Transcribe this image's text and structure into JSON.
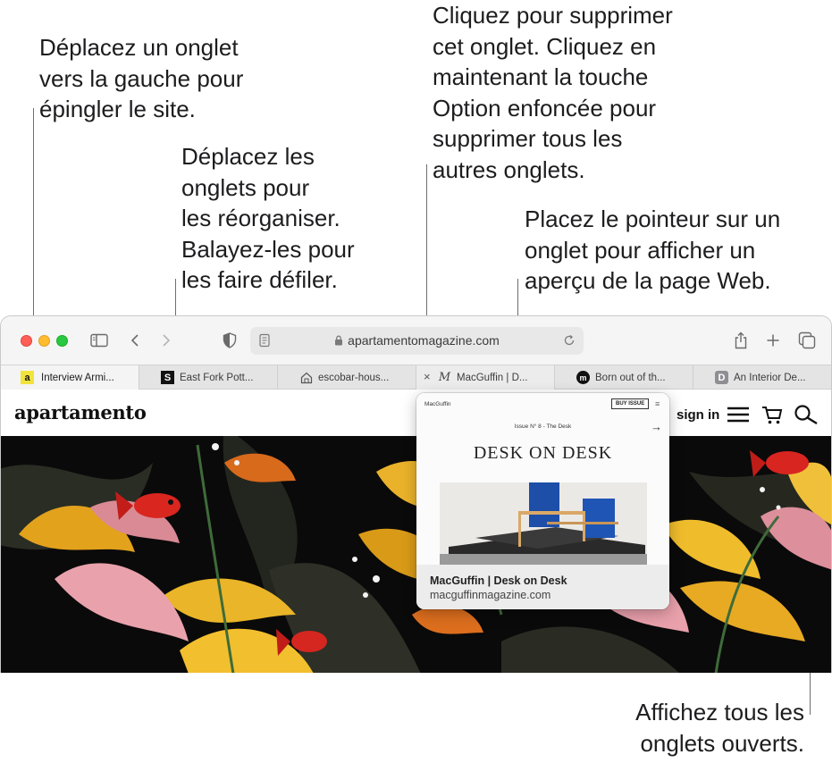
{
  "callouts": {
    "pin_tab": "Déplacez un onglet\nvers la gauche pour\népingler le site.",
    "reorder_tabs": "Déplacez les\nonglets pour\nles réorganiser.\nBalayez-les pour\nles faire défiler.",
    "close_tab": "Cliquez pour supprimer\ncet onglet. Cliquez en\nmaintenant la touche\nOption enfoncée pour\nsupprimer tous les\nautres onglets.",
    "hover_preview": "Placez le pointeur sur un\nonglet pour afficher un\naperçu de la page Web.",
    "show_all_tabs": "Affichez tous les\nonglets ouverts."
  },
  "toolbar": {
    "url": "apartamentomagazine.com",
    "icons": [
      "sidebar-icon",
      "back-icon",
      "forward-icon",
      "privacy-report-icon",
      "page-menu-icon",
      "lock-icon",
      "reload-icon",
      "share-icon",
      "new-tab-icon",
      "tab-overview-icon"
    ]
  },
  "tabs": [
    {
      "label": "Interview Armi...",
      "favicon": "a",
      "favicon_color": "#f2e33c",
      "favicon_text_color": "#111111"
    },
    {
      "label": "East Fork Pott...",
      "favicon": "S",
      "favicon_color": "#111111",
      "favicon_text_color": "#ffffff"
    },
    {
      "label": "escobar-hous...",
      "favicon": "",
      "favicon_color": "none",
      "favicon_text_color": "#555555"
    },
    {
      "label": "MacGuffin | D...",
      "favicon": "M",
      "favicon_color": "none",
      "favicon_text_color": "#444444"
    },
    {
      "label": "Born out of th...",
      "favicon": "m",
      "favicon_color": "#111111",
      "favicon_text_color": "#ffffff"
    },
    {
      "label": "An Interior De...",
      "favicon": "D",
      "favicon_color": "#8e8e93",
      "favicon_text_color": "#ffffff"
    }
  ],
  "close_glyph": "×",
  "site": {
    "logo": "apartamento",
    "signin": "sign in"
  },
  "preview": {
    "brand": "MacGuffin",
    "buy": "BUY ISSUE",
    "menu": "≡",
    "issue": "Issue N° 8 - The Desk",
    "arrow": "→",
    "headline": "DESK ON DESK",
    "title": "MacGuffin | Desk on Desk",
    "domain": "macguffinmagazine.com"
  },
  "colors": {
    "accent_red": "#ff5f57",
    "accent_yellow": "#febc2e",
    "accent_green": "#28c840",
    "hero_bg": "#0b0a0a"
  }
}
